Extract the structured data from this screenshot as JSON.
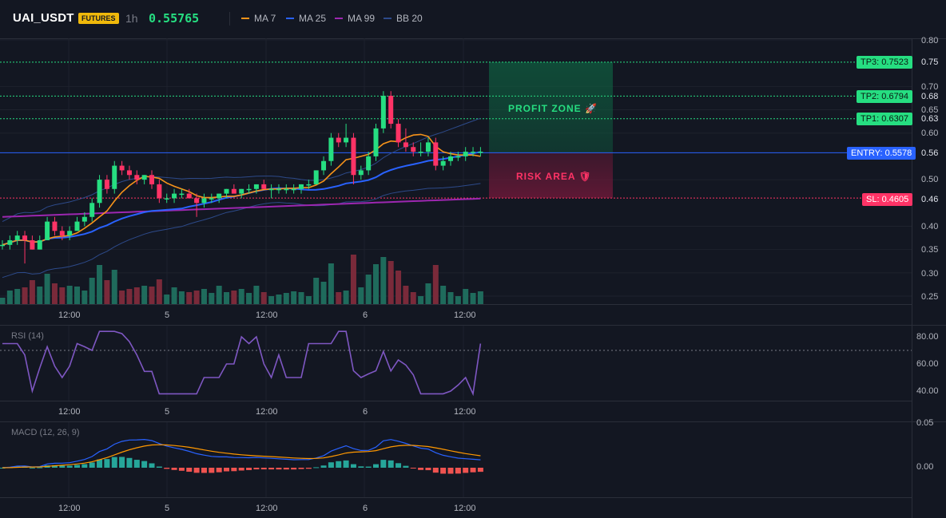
{
  "header": {
    "symbol": "UAI_USDT",
    "badge": "FUTURES",
    "timeframe": "1h",
    "price": "0.55765",
    "legend": [
      {
        "label": "MA 7",
        "color": "#f7931a"
      },
      {
        "label": "MA 25",
        "color": "#2962ff"
      },
      {
        "label": "MA 99",
        "color": "#9c27b0"
      },
      {
        "label": "BB 20",
        "color": "#2d4a8a"
      }
    ]
  },
  "levels": {
    "tp3": {
      "label": "TP3: 0.7523",
      "value": 0.7523,
      "axis": "0.75"
    },
    "tp2": {
      "label": "TP2: 0.6794",
      "value": 0.6794,
      "axis": "0.68"
    },
    "tp1": {
      "label": "TP1: 0.6307",
      "value": 0.6307,
      "axis": "0.63"
    },
    "entry": {
      "label": "ENTRY: 0.5578",
      "value": 0.5578,
      "axis": "0.56"
    },
    "sl": {
      "label": "SL: 0.4605",
      "value": 0.4605,
      "axis": "0.46"
    }
  },
  "zones": {
    "profit": "PROFIT ZONE 🚀",
    "risk": "RISK AREA 🛡"
  },
  "time_ticks": [
    "12:00",
    "5",
    "12:00",
    "6",
    "12:00"
  ],
  "price_axis": [
    "0.80",
    "0.70",
    "0.65",
    "0.60",
    "0.50",
    "0.40",
    "0.35",
    "0.30",
    "0.25"
  ],
  "rsi": {
    "title": "RSI (14)",
    "axis": [
      "80.00",
      "60.00",
      "40.00"
    ]
  },
  "macd": {
    "title": "MACD (12, 26, 9)",
    "axis": [
      "0.05",
      "0.00"
    ]
  },
  "colors": {
    "up": "#26de81",
    "down": "#ff3366",
    "ma7": "#f7931a",
    "ma25": "#2962ff",
    "ma99": "#9c27b0",
    "bb": "#2d4a8a",
    "rsi": "#7e57c2"
  },
  "chart_data": {
    "type": "candlestick",
    "ylim": [
      0.25,
      0.8
    ],
    "candles": [
      [
        0.36,
        0.37,
        0.35,
        0.36
      ],
      [
        0.36,
        0.38,
        0.35,
        0.37
      ],
      [
        0.37,
        0.39,
        0.36,
        0.38
      ],
      [
        0.38,
        0.39,
        0.32,
        0.37
      ],
      [
        0.37,
        0.38,
        0.35,
        0.35
      ],
      [
        0.35,
        0.38,
        0.35,
        0.37
      ],
      [
        0.37,
        0.42,
        0.37,
        0.41
      ],
      [
        0.41,
        0.42,
        0.38,
        0.39
      ],
      [
        0.39,
        0.4,
        0.37,
        0.38
      ],
      [
        0.38,
        0.4,
        0.37,
        0.39
      ],
      [
        0.39,
        0.42,
        0.39,
        0.41
      ],
      [
        0.41,
        0.43,
        0.4,
        0.42
      ],
      [
        0.42,
        0.46,
        0.41,
        0.45
      ],
      [
        0.45,
        0.51,
        0.44,
        0.5
      ],
      [
        0.5,
        0.51,
        0.47,
        0.48
      ],
      [
        0.48,
        0.54,
        0.47,
        0.53
      ],
      [
        0.53,
        0.54,
        0.51,
        0.52
      ],
      [
        0.52,
        0.53,
        0.5,
        0.51
      ],
      [
        0.51,
        0.52,
        0.49,
        0.5
      ],
      [
        0.5,
        0.51,
        0.49,
        0.51
      ],
      [
        0.51,
        0.52,
        0.48,
        0.49
      ],
      [
        0.49,
        0.5,
        0.45,
        0.46
      ],
      [
        0.46,
        0.47,
        0.45,
        0.46
      ],
      [
        0.46,
        0.48,
        0.45,
        0.47
      ],
      [
        0.47,
        0.48,
        0.46,
        0.47
      ],
      [
        0.47,
        0.48,
        0.46,
        0.46
      ],
      [
        0.46,
        0.47,
        0.42,
        0.45
      ],
      [
        0.45,
        0.47,
        0.44,
        0.46
      ],
      [
        0.46,
        0.47,
        0.45,
        0.46
      ],
      [
        0.46,
        0.47,
        0.45,
        0.47
      ],
      [
        0.47,
        0.48,
        0.46,
        0.48
      ],
      [
        0.48,
        0.49,
        0.47,
        0.47
      ],
      [
        0.47,
        0.48,
        0.46,
        0.48
      ],
      [
        0.48,
        0.49,
        0.47,
        0.48
      ],
      [
        0.48,
        0.49,
        0.47,
        0.49
      ],
      [
        0.49,
        0.5,
        0.48,
        0.48
      ],
      [
        0.48,
        0.49,
        0.46,
        0.48
      ],
      [
        0.48,
        0.49,
        0.47,
        0.48
      ],
      [
        0.48,
        0.49,
        0.47,
        0.48
      ],
      [
        0.48,
        0.49,
        0.47,
        0.48
      ],
      [
        0.48,
        0.49,
        0.47,
        0.49
      ],
      [
        0.49,
        0.5,
        0.48,
        0.49
      ],
      [
        0.49,
        0.52,
        0.49,
        0.52
      ],
      [
        0.52,
        0.55,
        0.51,
        0.54
      ],
      [
        0.54,
        0.6,
        0.53,
        0.59
      ],
      [
        0.59,
        0.6,
        0.57,
        0.58
      ],
      [
        0.58,
        0.62,
        0.57,
        0.59
      ],
      [
        0.59,
        0.6,
        0.49,
        0.51
      ],
      [
        0.51,
        0.53,
        0.5,
        0.52
      ],
      [
        0.52,
        0.56,
        0.51,
        0.55
      ],
      [
        0.55,
        0.62,
        0.54,
        0.61
      ],
      [
        0.61,
        0.69,
        0.6,
        0.68
      ],
      [
        0.68,
        0.69,
        0.61,
        0.62
      ],
      [
        0.62,
        0.63,
        0.57,
        0.58
      ],
      [
        0.58,
        0.61,
        0.56,
        0.57
      ],
      [
        0.57,
        0.58,
        0.55,
        0.56
      ],
      [
        0.56,
        0.58,
        0.55,
        0.56
      ],
      [
        0.56,
        0.59,
        0.55,
        0.58
      ],
      [
        0.58,
        0.59,
        0.52,
        0.53
      ],
      [
        0.53,
        0.55,
        0.52,
        0.54
      ],
      [
        0.54,
        0.56,
        0.53,
        0.55
      ],
      [
        0.55,
        0.56,
        0.54,
        0.55
      ],
      [
        0.55,
        0.57,
        0.54,
        0.56
      ],
      [
        0.56,
        0.57,
        0.55,
        0.56
      ],
      [
        0.56,
        0.57,
        0.55,
        0.56
      ]
    ]
  }
}
